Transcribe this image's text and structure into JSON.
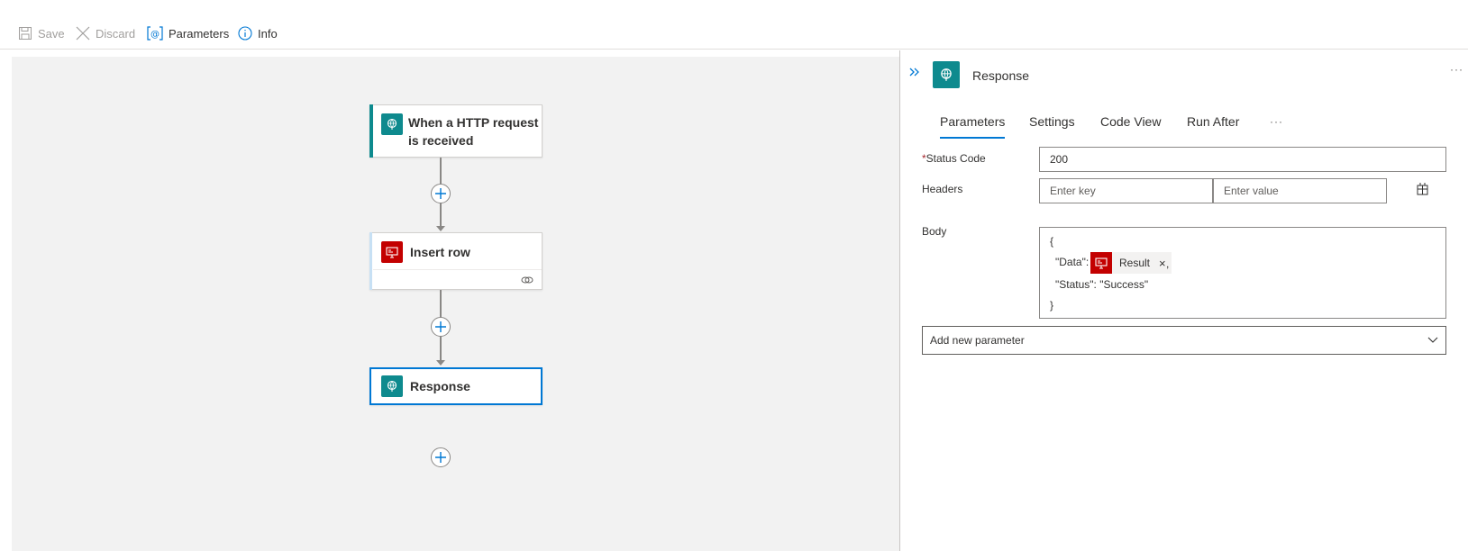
{
  "toolbar": {
    "save_label": "Save",
    "discard_label": "Discard",
    "parameters_label": "Parameters",
    "info_label": "Info"
  },
  "canvas": {
    "nodes": [
      {
        "title_line1": "When a HTTP request",
        "title_line2": "is received",
        "icon": "http-request-icon",
        "color": "#0e8a8e"
      },
      {
        "title": "Insert row",
        "icon": "sql-server-icon",
        "color": "#c30000"
      },
      {
        "title": "Response",
        "icon": "http-response-icon",
        "color": "#0e8a8e"
      }
    ]
  },
  "panel": {
    "title": "Response",
    "more": "···",
    "tabs": [
      "Parameters",
      "Settings",
      "Code View",
      "Run After"
    ],
    "tabs_more": "···",
    "status_code": {
      "required_mark": "*",
      "label": "Status Code",
      "value": "200"
    },
    "headers": {
      "label": "Headers",
      "key_placeholder": "Enter key",
      "value_placeholder": "Enter value"
    },
    "body": {
      "label": "Body",
      "open_brace": "{",
      "data_key": "\"Data\":",
      "token_label": "Result",
      "token_remove": "×",
      "trailing_comma": ",",
      "status_line": "\"Status\": \"Success\"",
      "close_brace": "}"
    },
    "add_param": {
      "label": "Add new parameter"
    }
  },
  "colors": {
    "accent": "#0078d4",
    "teal": "#0e8a8e",
    "sql_red": "#c30000"
  }
}
